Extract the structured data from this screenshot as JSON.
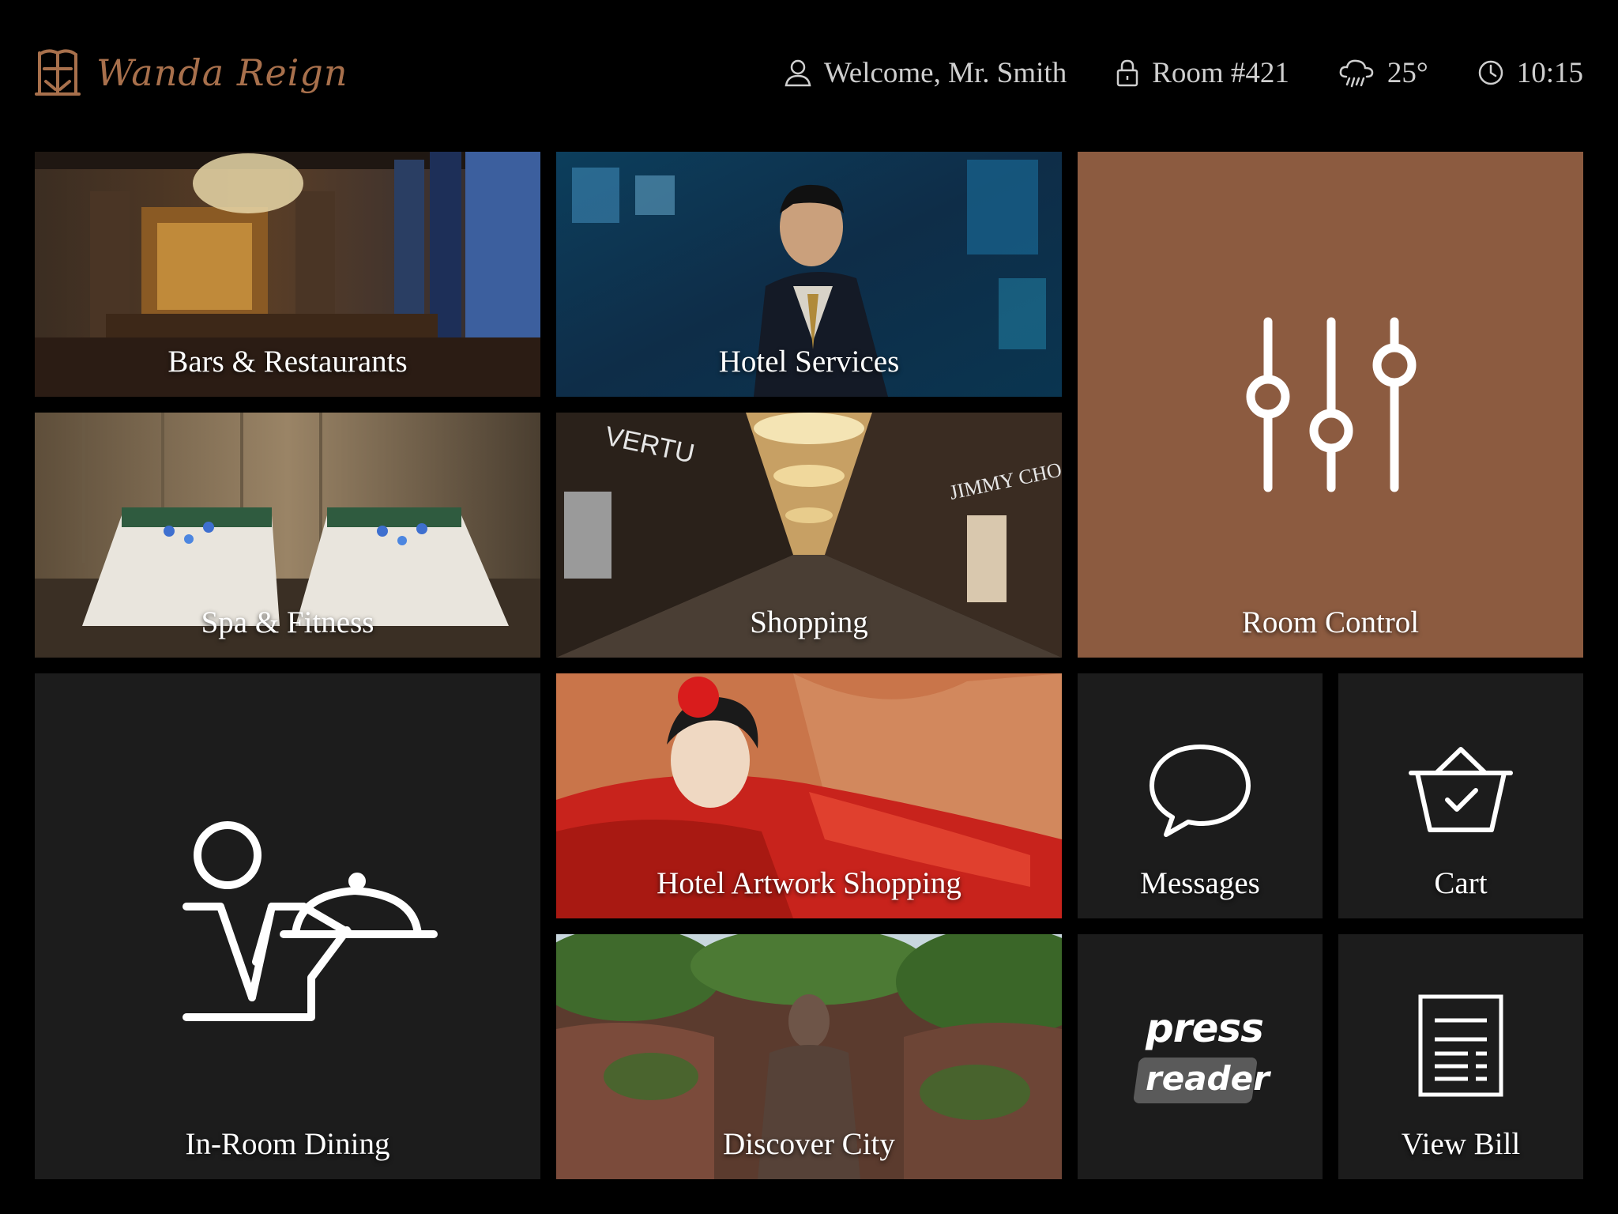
{
  "brand": {
    "name": "Wanda Reign",
    "color": "#a8704c"
  },
  "status_bar": {
    "welcome": "Welcome, Mr. Smith",
    "room": "Room #421",
    "temperature": "25°",
    "time": "10:15",
    "icons": [
      "user-icon",
      "lock-icon",
      "rain-cloud-icon",
      "clock-icon"
    ]
  },
  "tiles": {
    "bars_restaurants": "Bars & Restaurants",
    "hotel_services": "Hotel Services",
    "room_control": "Room Control",
    "spa_fitness": "Spa & Fitness",
    "shopping": "Shopping",
    "in_room_dining": "In-Room Dining",
    "hotel_artwork_shopping": "Hotel Artwork Shopping",
    "messages": "Messages",
    "cart": "Cart",
    "discover_city": "Discover City",
    "view_bill": "View Bill"
  },
  "press_reader": {
    "line1": "press",
    "line2": "reader"
  },
  "shop_signs": {
    "vertu": "VERTU",
    "jimmy_choo": "JIMMY CHOO"
  },
  "colors": {
    "accent_tile": "#8c5b40",
    "dark_tile": "#1c1c1c",
    "background": "#000000"
  }
}
